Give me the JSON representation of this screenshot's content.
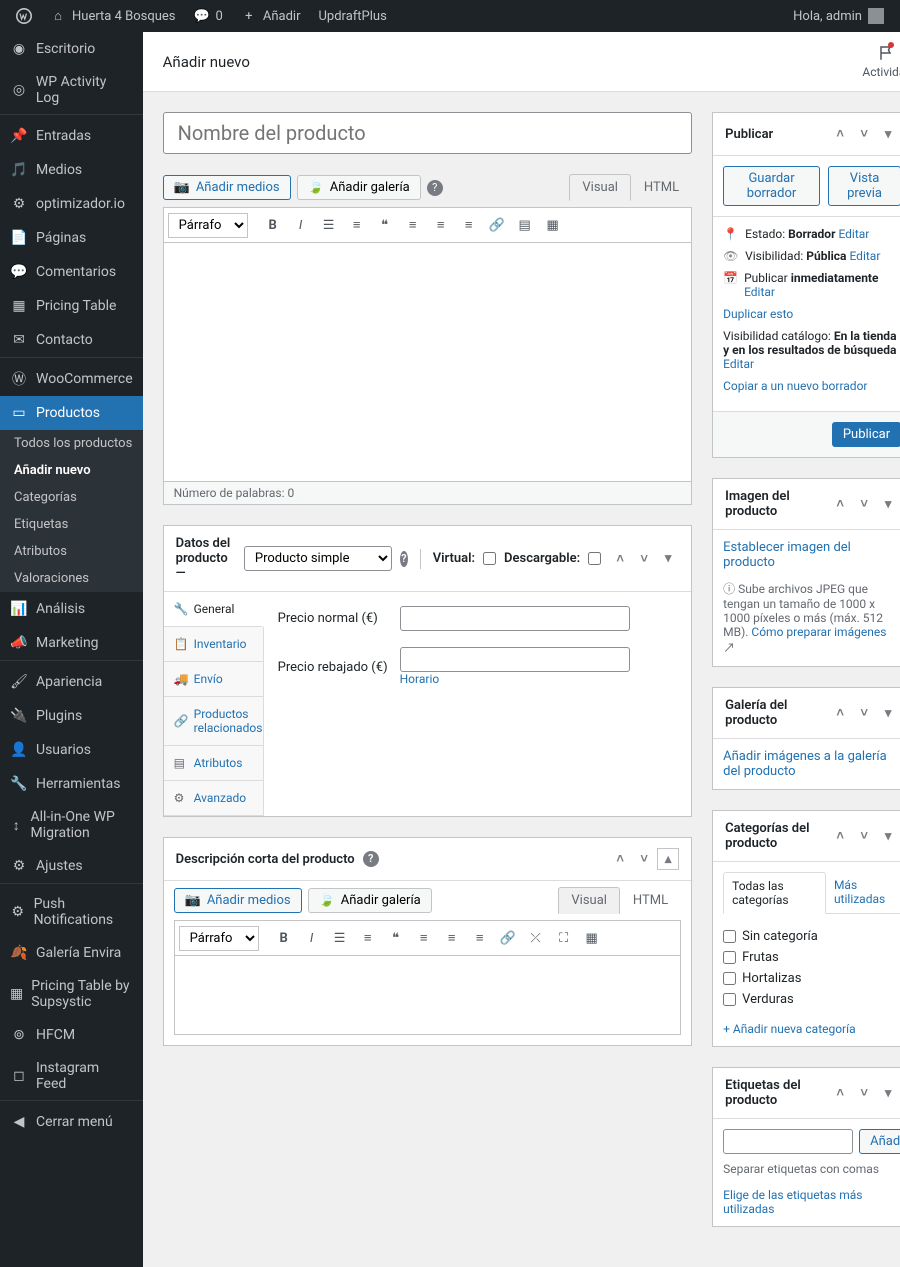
{
  "adminbar": {
    "site_name": "Huerta 4 Bosques",
    "comments_count": "0",
    "add_new": "Añadir",
    "updraft": "UpdraftPlus",
    "greeting": "Hola, admin"
  },
  "sidebar": {
    "items": [
      {
        "key": "dashboard",
        "label": "Escritorio"
      },
      {
        "key": "wpactivity",
        "label": "WP Activity Log"
      },
      {
        "key": "posts",
        "label": "Entradas"
      },
      {
        "key": "media",
        "label": "Medios"
      },
      {
        "key": "optimizador",
        "label": "optimizador.io"
      },
      {
        "key": "pages",
        "label": "Páginas"
      },
      {
        "key": "comments",
        "label": "Comentarios"
      },
      {
        "key": "pricingtable",
        "label": "Pricing Table"
      },
      {
        "key": "contact",
        "label": "Contacto"
      },
      {
        "key": "woocommerce",
        "label": "WooCommerce"
      },
      {
        "key": "products",
        "label": "Productos"
      },
      {
        "key": "analytics",
        "label": "Análisis"
      },
      {
        "key": "marketing",
        "label": "Marketing"
      },
      {
        "key": "appearance",
        "label": "Apariencia"
      },
      {
        "key": "plugins",
        "label": "Plugins"
      },
      {
        "key": "users",
        "label": "Usuarios"
      },
      {
        "key": "tools",
        "label": "Herramientas"
      },
      {
        "key": "aiowpm",
        "label": "All-in-One WP Migration"
      },
      {
        "key": "settings",
        "label": "Ajustes"
      },
      {
        "key": "push",
        "label": "Push Notifications"
      },
      {
        "key": "envira",
        "label": "Galería Envira"
      },
      {
        "key": "supsystic",
        "label": "Pricing Table by Supsystic"
      },
      {
        "key": "hfcm",
        "label": "HFCM"
      },
      {
        "key": "instagram",
        "label": "Instagram Feed"
      },
      {
        "key": "collapse",
        "label": "Cerrar menú"
      }
    ],
    "submenu_products": [
      {
        "label": "Todos los productos"
      },
      {
        "label": "Añadir nuevo"
      },
      {
        "label": "Categorías"
      },
      {
        "label": "Etiquetas"
      },
      {
        "label": "Atributos"
      },
      {
        "label": "Valoraciones"
      }
    ]
  },
  "header": {
    "title": "Añadir nuevo",
    "activity": "Actividad"
  },
  "product": {
    "title_placeholder": "Nombre del producto"
  },
  "editor": {
    "add_media": "Añadir medios",
    "add_gallery": "Añadir galería",
    "tab_visual": "Visual",
    "tab_html": "HTML",
    "paragraph": "Párrafo",
    "word_count": "Número de palabras: 0"
  },
  "product_data": {
    "title": "Datos del producto —",
    "type_option": "Producto simple",
    "virtual_label": "Virtual:",
    "downloadable_label": "Descargable:",
    "tabs": {
      "general": "General",
      "inventory": "Inventario",
      "shipping": "Envío",
      "linked": "Productos relacionados",
      "attributes": "Atributos",
      "advanced": "Avanzado"
    },
    "regular_price_label": "Precio normal (€)",
    "sale_price_label": "Precio rebajado (€)",
    "schedule": "Horario"
  },
  "short_desc": {
    "title": "Descripción corta del producto"
  },
  "publish": {
    "title": "Publicar",
    "save_draft": "Guardar borrador",
    "preview": "Vista previa",
    "status_label": "Estado:",
    "status_value": "Borrador",
    "visibility_label": "Visibilidad:",
    "visibility_value": "Pública",
    "publish_label": "Publicar",
    "publish_value": "inmediatamente",
    "edit": "Editar",
    "duplicate": "Duplicar esto",
    "catalog_label": "Visibilidad catálogo:",
    "catalog_value": "En la tienda y en los resultados de búsqueda",
    "copy_draft": "Copiar a un nuevo borrador",
    "button": "Publicar"
  },
  "image_box": {
    "title": "Imagen del producto",
    "set_image": "Establecer imagen del producto",
    "hint": "Sube archivos JPEG que tengan un tamaño de 1000 x 1000 píxeles o más (máx. 512 MB).",
    "hint_link": "Cómo preparar imágenes"
  },
  "gallery_box": {
    "title": "Galería del producto",
    "add": "Añadir imágenes a la galería del producto"
  },
  "categories_box": {
    "title": "Categorías del producto",
    "all": "Todas las categorías",
    "most": "Más utilizadas",
    "items": [
      "Sin categoría",
      "Frutas",
      "Hortalizas",
      "Verduras"
    ],
    "add_new": "+ Añadir nueva categoría"
  },
  "tags_box": {
    "title": "Etiquetas del producto",
    "add": "Añadir",
    "hint": "Separar etiquetas con comas",
    "choose": "Elige de las etiquetas más utilizadas"
  }
}
